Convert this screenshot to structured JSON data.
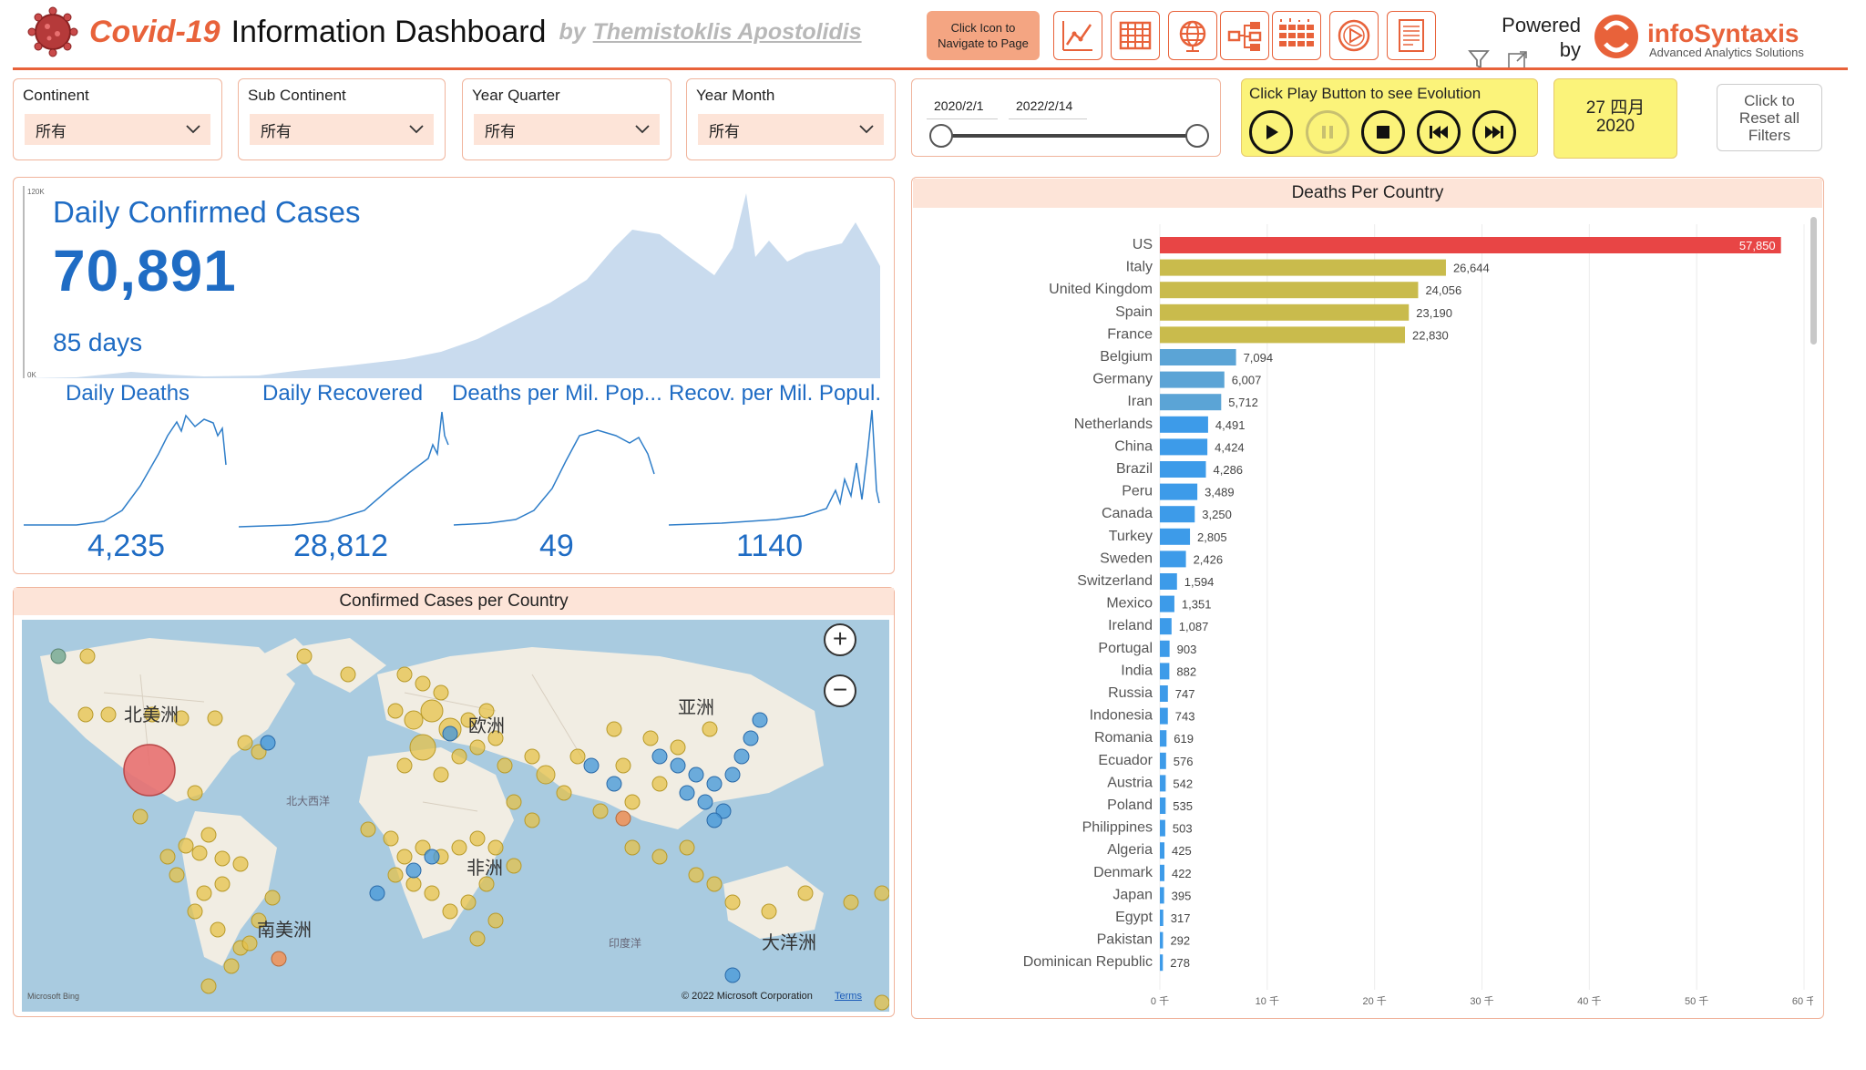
{
  "header": {
    "title_covid": "Covid-19",
    "title_rest": "Information Dashboard",
    "by": "by",
    "author": "Themistoklis Apostolidis",
    "nav_hint_line1": "Click Icon to",
    "nav_hint_line2": "Navigate to Page",
    "nav_icons": [
      "line-chart-icon",
      "table-grid-icon",
      "globe-icon",
      "tree-icon",
      "bar-grid-icon",
      "play-circle-icon",
      "report-icon"
    ],
    "powered_line1": "Powered",
    "powered_line2": "by",
    "logo_name": "infoSyntaxis",
    "logo_tagline": "Advanced Analytics Solutions",
    "accent": "#e8623a"
  },
  "slicers": [
    {
      "label": "Continent",
      "value": "所有"
    },
    {
      "label": "Sub Continent",
      "value": "所有"
    },
    {
      "label": "Year Quarter",
      "value": "所有"
    },
    {
      "label": "Year Month",
      "value": "所有"
    }
  ],
  "date_slicer": {
    "start": "2020/2/1",
    "end": "2022/2/14"
  },
  "playback": {
    "hint": "Click Play Button to see Evolution",
    "controls": [
      "play",
      "pause",
      "stop",
      "previous",
      "next"
    ],
    "current_date_line1": "27 四月",
    "current_date_line2": "2020"
  },
  "reset": {
    "line1": "Click to",
    "line2": "Reset all",
    "line3": "Filters"
  },
  "kpi": {
    "title": "Daily Confirmed Cases",
    "value": "70,891",
    "days": "85 days",
    "axis_top": "120K",
    "axis_bottom": "0K",
    "mini": [
      {
        "label": "Daily Deaths",
        "value": "4,235"
      },
      {
        "label": "Daily Recovered",
        "value": "28,812"
      },
      {
        "label": "Deaths per Mil. Pop...",
        "value": "49"
      },
      {
        "label": "Recov. per Mil. Popul.",
        "value": "1140"
      }
    ]
  },
  "map": {
    "title": "Confirmed Cases per Country",
    "labels": {
      "north_america": "北美洲",
      "south_america": "南美洲",
      "europe": "欧洲",
      "asia": "亚洲",
      "africa": "非洲",
      "oceania": "大洋洲",
      "north_atlantic": "北大西洋",
      "indian_ocean": "印度洋"
    },
    "attribution": "© 2022 Microsoft Corporation",
    "terms": "Terms",
    "bing": "Microsoft Bing",
    "zoom_in": "+",
    "zoom_out": "−"
  },
  "chart_data": {
    "type": "bar",
    "title": "Deaths Per Country",
    "orientation": "horizontal",
    "categories": [
      "US",
      "Italy",
      "United Kingdom",
      "Spain",
      "France",
      "Belgium",
      "Germany",
      "Iran",
      "Netherlands",
      "China",
      "Brazil",
      "Peru",
      "Canada",
      "Turkey",
      "Sweden",
      "Switzerland",
      "Mexico",
      "Ireland",
      "Portugal",
      "India",
      "Russia",
      "Indonesia",
      "Romania",
      "Ecuador",
      "Austria",
      "Poland",
      "Philippines",
      "Algeria",
      "Denmark",
      "Japan",
      "Egypt",
      "Pakistan",
      "Dominican Republic"
    ],
    "values": [
      57850,
      26644,
      24056,
      23190,
      22830,
      7094,
      6007,
      5712,
      4491,
      4424,
      4286,
      3489,
      3250,
      2805,
      2426,
      1594,
      1351,
      1087,
      903,
      882,
      747,
      743,
      619,
      576,
      542,
      535,
      503,
      425,
      422,
      395,
      317,
      292,
      278
    ],
    "labels": [
      "57,850",
      "26,644",
      "24,056",
      "23,190",
      "22,830",
      "7,094",
      "6,007",
      "5,712",
      "4,491",
      "4,424",
      "4,286",
      "3,489",
      "3,250",
      "2,805",
      "2,426",
      "1,594",
      "1,351",
      "1,087",
      "903",
      "882",
      "747",
      "743",
      "619",
      "576",
      "542",
      "535",
      "503",
      "425",
      "422",
      "395",
      "317",
      "292",
      "278"
    ],
    "colors": {
      "top": "#e84545",
      "high": "#c9bb4c",
      "mid": "#5ba4d6",
      "low": "#3d9be9"
    },
    "x_ticks": [
      "0 千",
      "10 千",
      "20 千",
      "30 千",
      "40 千",
      "50 千",
      "60 千"
    ],
    "xlim": [
      0,
      60000
    ],
    "grid": true
  }
}
